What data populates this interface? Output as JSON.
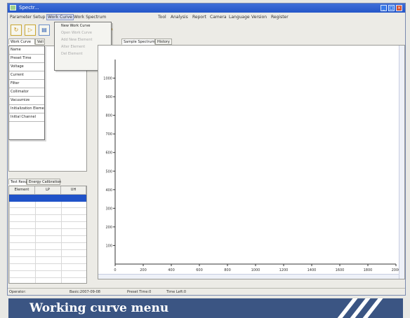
{
  "window": {
    "title": "Spectr..."
  },
  "menubar": {
    "items": [
      "Parameter",
      "Setup",
      "Work Curve",
      "Work Spectrum"
    ],
    "right_items": [
      "Tool",
      "Analysis",
      "Report",
      "Camera",
      "Language",
      "Version",
      "Register"
    ]
  },
  "left_tabs": {
    "top": [
      "Work Curve",
      "Vali"
    ],
    "bottom": [
      "Test Result",
      "Energy Calibration"
    ]
  },
  "context_list": [
    "Name",
    "Preset Time",
    "Voltage",
    "Current",
    "Filter",
    "Collimator",
    "Vacuumize",
    "Initialization Element",
    "Initial Channel"
  ],
  "bottom_grid": {
    "columns": [
      "Element",
      "LP",
      "UH"
    ]
  },
  "dropdown": {
    "items": [
      {
        "label": "New Work Curve",
        "enabled": true
      },
      {
        "label": "Open Work Curve",
        "enabled": false
      },
      {
        "label": "Add New Element",
        "enabled": false
      },
      {
        "label": "Alter Element",
        "enabled": false
      },
      {
        "label": "Del Element",
        "enabled": false
      }
    ]
  },
  "chart_tabs": [
    "Sample Spectrum",
    "History"
  ],
  "chart_data": {
    "type": "line",
    "series": [],
    "x_ticks": [
      "0",
      "200",
      "400",
      "600",
      "800",
      "1000",
      "1200",
      "1400",
      "1600",
      "1800",
      "2000"
    ],
    "y_ticks": [
      "100",
      "200",
      "300",
      "400",
      "500",
      "600",
      "700",
      "800",
      "900",
      "1000"
    ],
    "xlim": [
      0,
      2000
    ],
    "ylim": [
      0,
      1100
    ]
  },
  "statusbar": {
    "operator": "Operator:",
    "items": [
      "Basic:2007-09-08",
      "Preset Time:0",
      "Time Left:0"
    ]
  },
  "caption": "Working curve menu",
  "colors": {
    "accent": "#1f52c8",
    "banner": "#3b5583",
    "titlebar": "#2456c8"
  }
}
